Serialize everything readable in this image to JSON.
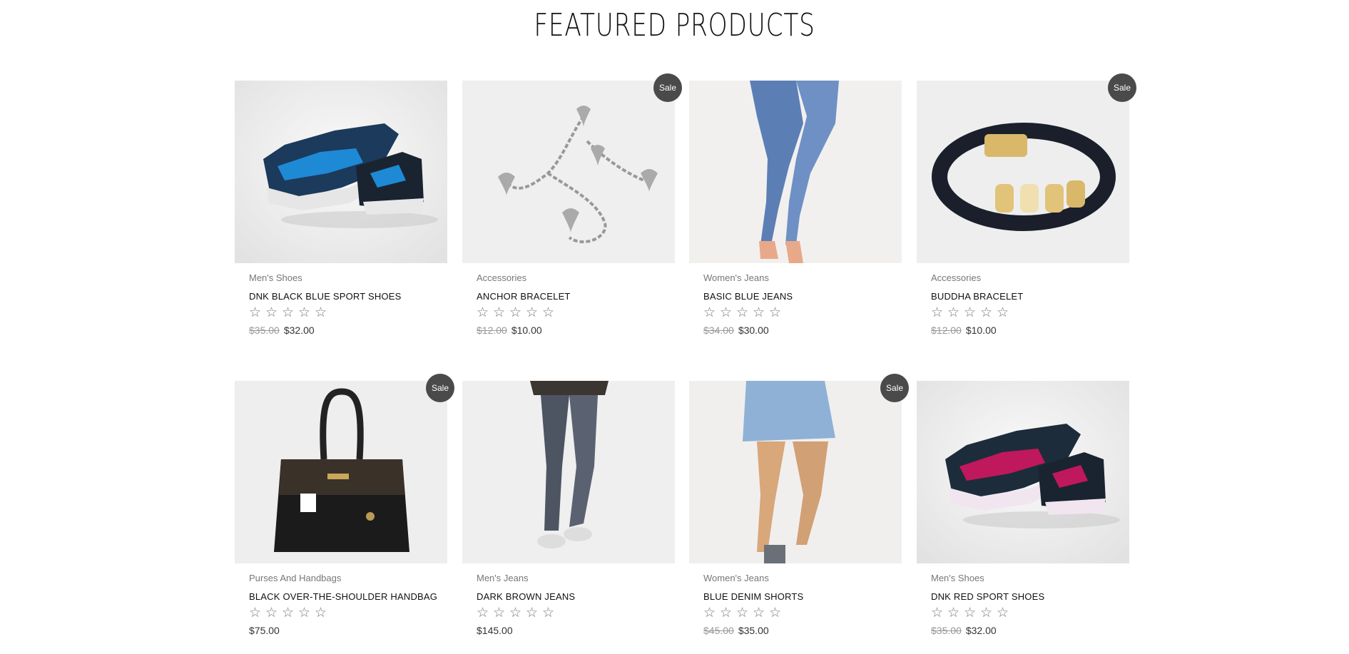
{
  "section": {
    "title": "FEATURED PRODUCTS"
  },
  "sale_label": "Sale",
  "star_glyph": "☆",
  "products": [
    {
      "category": "Men's Shoes",
      "title": "DNK BLACK BLUE SPORT SHOES",
      "old_price": "$35.00",
      "price": "$32.00",
      "sale": false,
      "rating": 0,
      "image": "blue-sneaker"
    },
    {
      "category": "Accessories",
      "title": "ANCHOR BRACELET",
      "old_price": "$12.00",
      "price": "$10.00",
      "sale": true,
      "rating": 0,
      "image": "heart-charm-bracelet"
    },
    {
      "category": "Women's Jeans",
      "title": "BASIC BLUE JEANS",
      "old_price": "$34.00",
      "price": "$30.00",
      "sale": false,
      "rating": 0,
      "image": "blue-jeans-legs"
    },
    {
      "category": "Accessories",
      "title": "BUDDHA BRACELET",
      "old_price": "$12.00",
      "price": "$10.00",
      "sale": true,
      "rating": 0,
      "image": "braided-bracelet"
    },
    {
      "category": "Purses And Handbags",
      "title": "BLACK OVER-THE-SHOULDER HANDBAG",
      "old_price": "",
      "price": "$75.00",
      "sale": true,
      "rating": 0,
      "image": "black-handbag"
    },
    {
      "category": "Men's Jeans",
      "title": "DARK BROWN JEANS",
      "old_price": "",
      "price": "$145.00",
      "sale": false,
      "rating": 0,
      "image": "dark-jeans"
    },
    {
      "category": "Women's Jeans",
      "title": "BLUE DENIM SHORTS",
      "old_price": "$45.00",
      "price": "$35.00",
      "sale": true,
      "rating": 0,
      "image": "denim-shorts"
    },
    {
      "category": "Men's Shoes",
      "title": "DNK RED SPORT SHOES",
      "old_price": "$35.00",
      "price": "$32.00",
      "sale": false,
      "rating": 0,
      "image": "red-sneaker"
    }
  ],
  "colors": {
    "badge": "#4a4a4a",
    "thumb_bg": "#ececec",
    "category": "#777777",
    "old_price": "#999999"
  }
}
